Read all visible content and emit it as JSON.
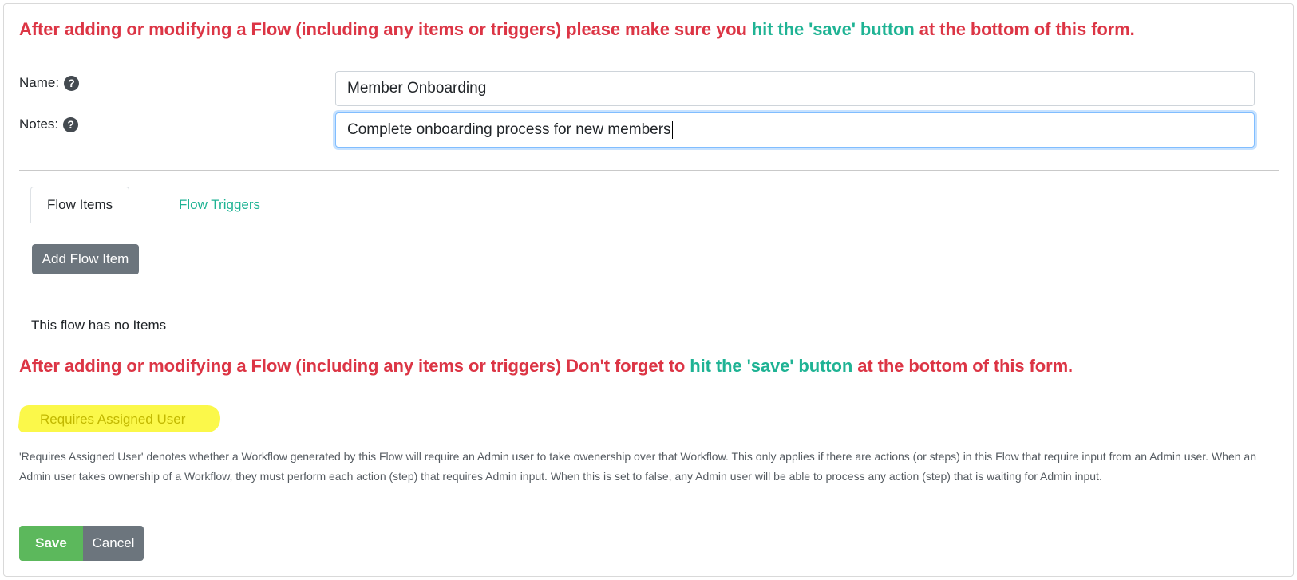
{
  "notice_top": {
    "before": "After adding or modifying a Flow (including any items or triggers) please make sure you ",
    "highlight": "hit the 'save' button",
    "after": " at the bottom of this form."
  },
  "form": {
    "name_label": "Name:",
    "name_value": "Member Onboarding",
    "notes_label": "Notes:",
    "notes_value": "Complete onboarding process for new members",
    "help_glyph": "?"
  },
  "tabs": [
    {
      "label": "Flow Items",
      "active": true
    },
    {
      "label": "Flow Triggers",
      "active": false
    }
  ],
  "flow_items": {
    "add_button_label": "Add Flow Item",
    "empty_message": "This flow has no Items"
  },
  "notice_bottom": {
    "before": "After adding or modifying a Flow (including any items or triggers) Don't forget to ",
    "highlight": "hit the 'save' button",
    "after": " at the bottom of this form."
  },
  "requires_assigned_user": {
    "label": "Requires Assigned User",
    "description": "'Requires Assigned User' denotes whether a Workflow generated by this Flow will require an Admin user to take owenership over that Workflow. This only applies if there are actions (or steps) in this Flow that require input from an Admin user. When an Admin user takes ownership of a Workflow, they must perform each action (step) that requires Admin input. When this is set to false, any Admin user will be able to process any action (step) that is waiting for Admin input."
  },
  "actions": {
    "save_label": "Save",
    "cancel_label": "Cancel"
  },
  "colors": {
    "warning": "#dc3545",
    "accent": "#1fb394",
    "secondary_button": "#6c757d",
    "save_button": "#5cb85c",
    "marker_highlight": "#fbf84a"
  }
}
